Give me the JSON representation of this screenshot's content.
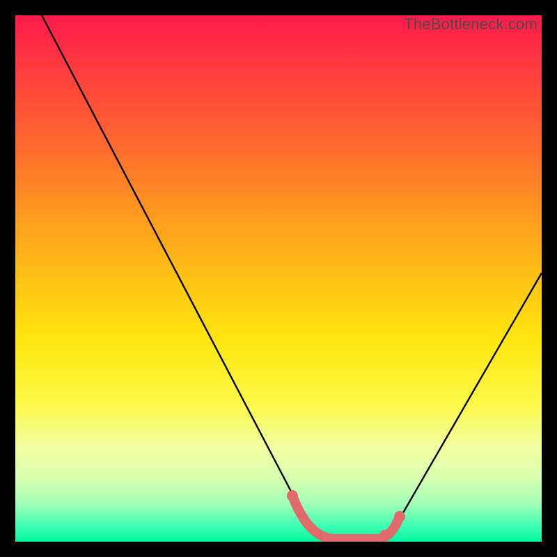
{
  "watermark": "TheBottleneck.com",
  "chart_data": {
    "type": "line",
    "title": "",
    "xlabel": "",
    "ylabel": "",
    "xlim": [
      0,
      100
    ],
    "ylim": [
      0,
      100
    ],
    "series": [
      {
        "name": "bottleneck-curve",
        "x": [
          5,
          10,
          15,
          20,
          25,
          30,
          35,
          40,
          45,
          50,
          52,
          55,
          58,
          60,
          63,
          65,
          68,
          70,
          75,
          80,
          85,
          90,
          95,
          100
        ],
        "y": [
          100,
          90,
          80,
          70,
          60,
          50,
          40,
          30,
          20,
          10,
          5,
          2,
          0,
          0,
          0,
          0,
          2,
          5,
          12,
          22,
          32,
          43,
          54,
          60
        ]
      }
    ],
    "highlight": {
      "name": "optimal-range",
      "color": "#e26a6a",
      "points_x": [
        52,
        54,
        56,
        58,
        60,
        62,
        64,
        66,
        68,
        70
      ],
      "points_y": [
        5,
        3,
        1,
        0,
        0,
        0,
        0,
        1,
        3,
        6
      ]
    },
    "gradient_stops": [
      {
        "pos": 0.0,
        "color": "#ff1a4b"
      },
      {
        "pos": 0.5,
        "color": "#ffc215"
      },
      {
        "pos": 0.82,
        "color": "#f2ffa0"
      },
      {
        "pos": 1.0,
        "color": "#00f7a0"
      }
    ]
  }
}
